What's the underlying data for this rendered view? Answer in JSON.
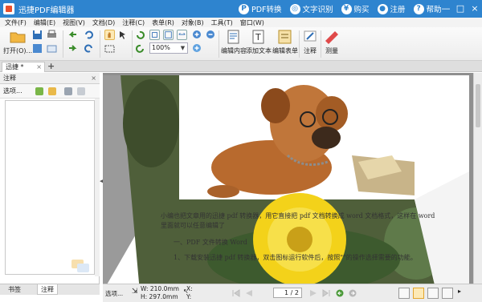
{
  "titlebar": {
    "app_name": "迅捷PDF编辑器",
    "links": [
      "PDF转换",
      "文字识别",
      "购买",
      "注册",
      "帮助"
    ],
    "window_buttons": [
      "—",
      "□",
      "×"
    ]
  },
  "menu": [
    "文件(F)",
    "编辑(E)",
    "视图(V)",
    "文档(D)",
    "注释(C)",
    "表单(R)",
    "对象(B)",
    "工具(T)",
    "窗口(W)"
  ],
  "ribbon": {
    "open_label": "打开(O)...",
    "zoom_value": "100%",
    "edit_content": "编辑内容",
    "add_text": "添加文本",
    "edit_form": "编辑表单",
    "annotate": "注释",
    "measure": "测量"
  },
  "doc_tab": {
    "label": "迅捷 *",
    "new_tab": "+"
  },
  "left_panel": {
    "title": "注释",
    "options": "选项...",
    "bottom_tabs": [
      "书签",
      "注释"
    ]
  },
  "document": {
    "paragraph1": "小编也把文章用的迅捷 pdf 转换器，用它直接把 pdf 文档转换成 word 文档格式，这样在 word",
    "paragraph1b": "里面就可以任意编辑了",
    "heading": "一、PDF 文件转换 Word",
    "step1": "1、下载安装迅捷 pdf 转换器，双击图标运行软件后，按照\"\"的操作选择需要的功能。"
  },
  "statusbar": {
    "options": "选项...",
    "width": "W: 210.0mm",
    "height": "H: 297.0mm",
    "x_label": "X:",
    "y_label": "Y:",
    "page": "1 / 2"
  },
  "colors": {
    "titlebar": "#2e84cf",
    "accent_red": "#e94f2c"
  }
}
